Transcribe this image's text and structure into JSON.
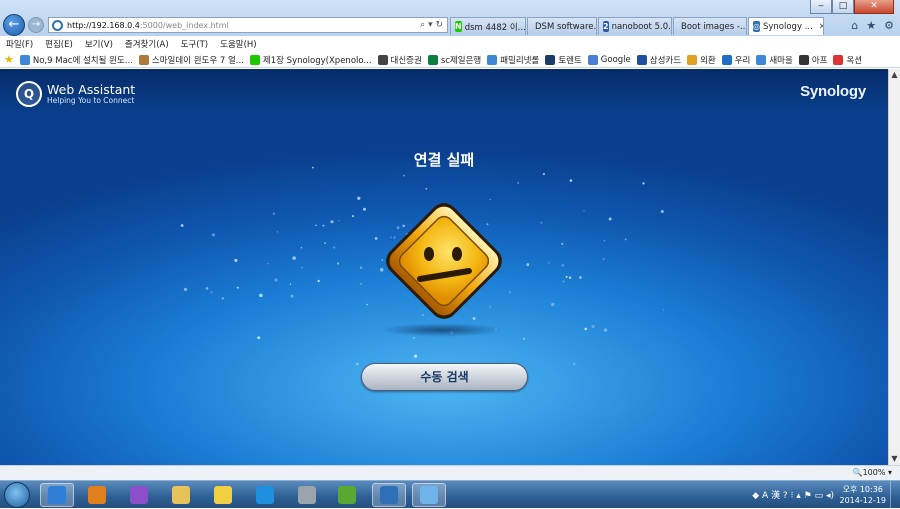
{
  "window": {
    "minimize": "‒",
    "maximize": "□",
    "close": "✕"
  },
  "address": {
    "host": "http://192.168.0.4",
    "path": ":5000/web_index.html",
    "controls": "⌕ ▾ ↻"
  },
  "tabs": [
    {
      "label": "dsm 4482 이...",
      "icon": "naver-icon",
      "color": "#1ec800",
      "glyph": "N"
    },
    {
      "label": "DSM software...",
      "icon": "page-icon",
      "color": "#3b8ad8",
      "glyph": ""
    },
    {
      "label": "nanoboot 5.0...",
      "icon": "2-icon",
      "color": "#2a5caa",
      "glyph": "2"
    },
    {
      "label": "Boot images -...",
      "icon": "page-icon",
      "color": "#3b8ad8",
      "glyph": ""
    },
    {
      "label": "Synology ...",
      "icon": "synology-icon",
      "color": "#2f6fb7",
      "glyph": "◎"
    }
  ],
  "menu": [
    "파일(F)",
    "편집(E)",
    "보기(V)",
    "즐겨찾기(A)",
    "도구(T)",
    "도움말(H)"
  ],
  "favorites": [
    {
      "label": "No,9  Mac에 설치될 윈도...",
      "color": "#3e86d6"
    },
    {
      "label": "스마일데이 윈도우 7 얼...",
      "color": "#b07a3c"
    },
    {
      "label": "제1장 Synology(Xpenolo...",
      "color": "#1ec800"
    },
    {
      "label": "대신증권",
      "color": "#444"
    },
    {
      "label": "sc제일은행",
      "color": "#0a7f3f"
    },
    {
      "label": "패밀리넷롤",
      "color": "#3e86d6"
    },
    {
      "label": "토렌트",
      "color": "#1b3c6b"
    },
    {
      "label": "Google",
      "color": "#4a7fd4"
    },
    {
      "label": "삼성카드",
      "color": "#1f4fa0"
    },
    {
      "label": "외환",
      "color": "#e0a020"
    },
    {
      "label": "우리",
      "color": "#1d6fc5"
    },
    {
      "label": "새마을",
      "color": "#3e86d6"
    },
    {
      "label": "아프",
      "color": "#333"
    },
    {
      "label": "옥션",
      "color": "#d33"
    }
  ],
  "app": {
    "logo_title": "Web Assistant",
    "logo_subtitle": "Helping You to Connect",
    "brand": "Synology",
    "heading": "연결 실패",
    "manual_button": "수동 검색"
  },
  "status": {
    "zoom": "🔍100%  ▾"
  },
  "taskbar": {
    "items": [
      "ie",
      "media",
      "vs",
      "explorer",
      "folder",
      "teamviewer",
      "calc",
      "utorrent",
      "web-assistant",
      "paint"
    ],
    "tray": "◆ A 漢 ? ⁝ ▴ ⚑ ▭ ◂)",
    "time": "오후 10:36",
    "date": "2014-12-19"
  }
}
